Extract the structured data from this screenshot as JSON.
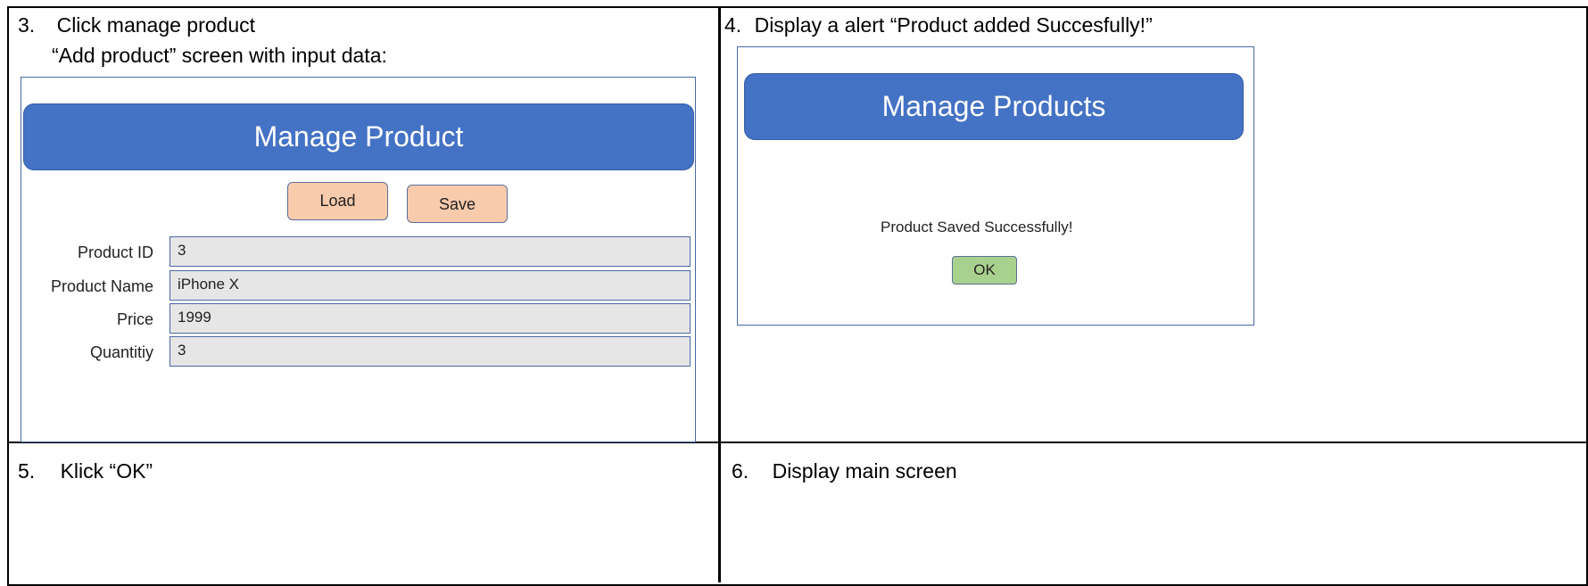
{
  "steps": {
    "s3": {
      "num": "3.",
      "label": "Click manage product",
      "sub": "“Add product” screen with input data:"
    },
    "s4": {
      "num": "4.",
      "label": "Display a alert “Product added Succesfully!”"
    },
    "s5": {
      "num": "5.",
      "label": "Klick “OK”"
    },
    "s6": {
      "num": "6.",
      "label": "Display main screen"
    }
  },
  "manage_product": {
    "title": "Manage Product",
    "load_label": "Load",
    "save_label": "Save",
    "fields": [
      {
        "label": "Product ID",
        "value": "3"
      },
      {
        "label": "Product Name",
        "value": "iPhone X"
      },
      {
        "label": "Price",
        "value": "1999"
      },
      {
        "label": "Quantitiy",
        "value": "3"
      }
    ]
  },
  "alert_screen": {
    "title": "Manage Products",
    "message": "Product Saved Successfully!",
    "ok_label": "OK"
  },
  "colors": {
    "banner": "#4472c4",
    "button": "#f8cbad",
    "ok_button": "#a9d18e",
    "field_bg": "#e7e6e6"
  }
}
